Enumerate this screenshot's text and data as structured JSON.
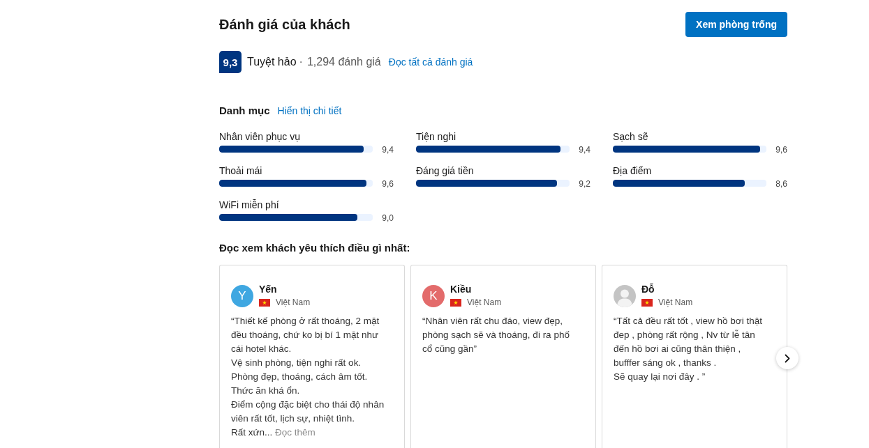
{
  "header": {
    "title": "Đánh giá của khách",
    "button": "Xem phòng trống"
  },
  "score": {
    "value": "9,3",
    "label": "Tuyệt hảo",
    "separator": "·",
    "count": "1,294 đánh giá",
    "link": "Đọc tất cả đánh giá"
  },
  "categories": {
    "title": "Danh mục",
    "link": "Hiển thị chi tiết",
    "items": [
      {
        "name": "Nhân viên phục vụ",
        "level": 0.94,
        "score": "9,4"
      },
      {
        "name": "Tiện nghi",
        "level": 0.94,
        "score": "9,4"
      },
      {
        "name": "Sạch sẽ",
        "level": 0.96,
        "score": "9,6"
      },
      {
        "name": "Thoải mái",
        "level": 0.96,
        "score": "9,6"
      },
      {
        "name": "Đáng giá tiền",
        "level": 0.92,
        "score": "9,2"
      },
      {
        "name": "Địa điểm",
        "level": 0.86,
        "score": "8,6"
      },
      {
        "name": "WiFi miễn phí",
        "level": 0.9,
        "score": "9,0"
      }
    ]
  },
  "highlights": {
    "title": "Đọc xem khách yêu thích điều gì nhất:",
    "reviews": [
      {
        "name": "Yến",
        "country": "Việt Nam",
        "avatar": {
          "kind": "initial",
          "initial": "Y",
          "color": "#3fa7e1"
        },
        "text": "“Thiết kế phòng ở rất thoáng, 2 mặt đều thoáng, chứ ko bị bí 1 mặt như cái hotel khác.\nVệ sinh phòng, tiện nghi rất ok.\nPhòng đẹp, thoáng, cách âm tốt.\nThức ăn khá ổn.\nĐiểm cộng đặc biệt cho thái độ nhân viên rất tốt, lịch sự, nhiệt tình.\nRất xứn...",
        "more_link": "Đọc thêm"
      },
      {
        "name": "Kiều",
        "country": "Việt Nam",
        "avatar": {
          "kind": "initial",
          "initial": "K",
          "color": "#e36b6b"
        },
        "text": "“Nhân viên rất chu đáo, view đẹp, phòng sạch sẽ và thoáng, đi ra phố cổ cũng gần”"
      },
      {
        "name": "Đỗ",
        "country": "Việt Nam",
        "avatar": {
          "kind": "silhouette"
        },
        "text": "“Tất cả đều rất tốt , view hồ bơi thật đep , phòng rất rộng , Nv từ lễ tân đến hồ bơi ai cũng thân thiện ,\nbufffer sáng ok , thanks .\nSẽ quay lại nơi đây . ”"
      }
    ]
  }
}
